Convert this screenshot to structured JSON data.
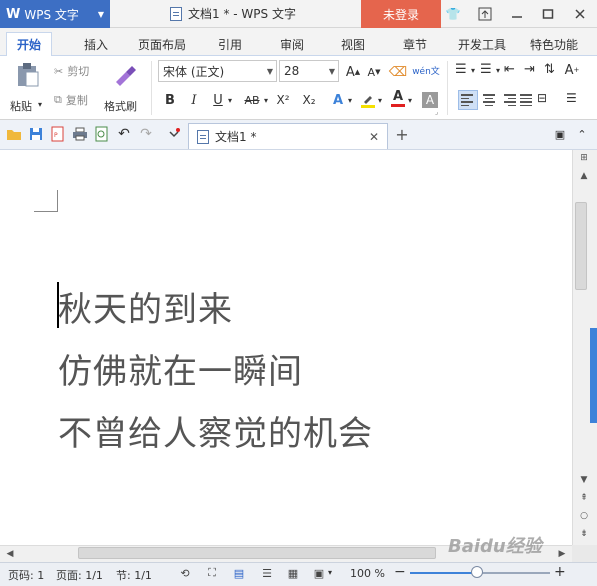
{
  "app": {
    "name": "WPS 文字",
    "window_title": "文档1 * - WPS 文字",
    "login_label": "未登录"
  },
  "tabs": [
    {
      "label": "开始",
      "active": true
    },
    {
      "label": "插入"
    },
    {
      "label": "页面布局"
    },
    {
      "label": "引用"
    },
    {
      "label": "审阅"
    },
    {
      "label": "视图"
    },
    {
      "label": "章节"
    },
    {
      "label": "开发工具"
    },
    {
      "label": "特色功能"
    }
  ],
  "ribbon": {
    "paste_label": "粘贴",
    "cut_label": "剪切",
    "copy_label": "复制",
    "format_painter_label": "格式刷",
    "font_name": "宋体 (正文)",
    "font_size": "28",
    "bold": "B",
    "italic": "I",
    "underline": "U",
    "strike": "AB",
    "superscript": "X²",
    "subscript": "X₂",
    "phonetic_label": "wén文"
  },
  "doc_tab": {
    "label": "文档1 *"
  },
  "document": {
    "lines": [
      "秋天的到来",
      "仿佛就在一瞬间",
      "不曾给人察觉的机会"
    ]
  },
  "status": {
    "page_label": "页码: 1",
    "pages_label": "页面: 1/1",
    "section_label": "节: 1/1",
    "zoom_label": "100 %",
    "zoom_value": 0.48,
    "minus": "−",
    "plus": "+"
  },
  "colors": {
    "accent": "#3d6fc4",
    "login": "#e5654d",
    "highlight_marker": "#f5e000",
    "font_color_marker": "#e02020"
  },
  "watermark": "Baidu经验"
}
